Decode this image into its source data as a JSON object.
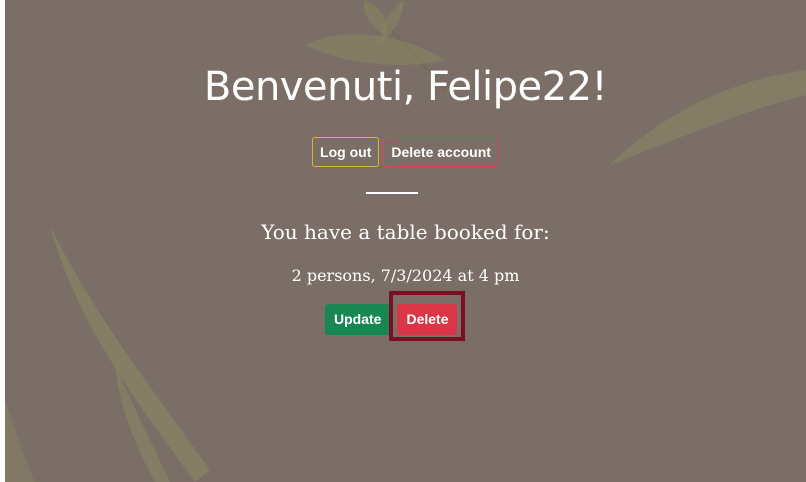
{
  "header": {
    "greeting": "Benvenuti, Felipe22!"
  },
  "account_actions": {
    "logout_label": "Log out",
    "delete_account_label": "Delete account"
  },
  "booking": {
    "heading": "You have a table booked for:",
    "details": "2 persons, 7/3/2024 at 4 pm",
    "update_label": "Update",
    "delete_label": "Delete"
  },
  "colors": {
    "background": "#7b6e66",
    "logout_border": "#e0b23a",
    "delete_account_border": "#d9485b",
    "update_button": "#198754",
    "delete_button": "#dc3545",
    "highlight": "#7a0f23"
  }
}
